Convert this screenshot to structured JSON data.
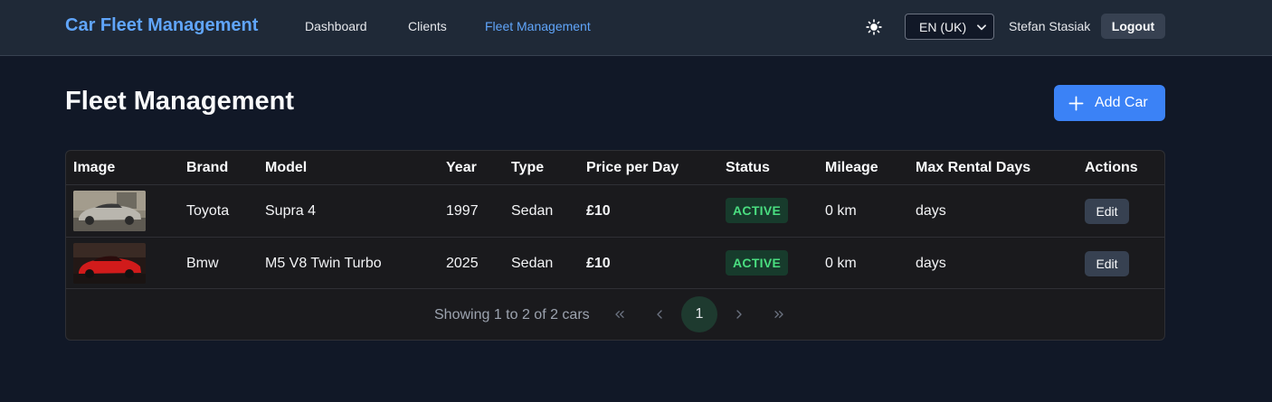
{
  "nav": {
    "brand": "Car Fleet Management",
    "links": [
      "Dashboard",
      "Clients",
      "Fleet Management"
    ],
    "active_link": "Fleet Management",
    "theme_icon": "sun-icon",
    "language": "EN (UK)",
    "user": "Stefan Stasiak",
    "logout_label": "Logout"
  },
  "page": {
    "title": "Fleet Management",
    "add_button_label": "Add Car"
  },
  "table": {
    "headers": [
      "Image",
      "Brand",
      "Model",
      "Year",
      "Type",
      "Price per Day",
      "Status",
      "Mileage",
      "Max Rental Days",
      "Actions"
    ],
    "rows": [
      {
        "brand": "Toyota",
        "model": "Supra 4",
        "year": "1997",
        "type": "Sedan",
        "price": "£10",
        "status": "ACTIVE",
        "mileage": "0 km",
        "max_days": "days",
        "action": "Edit"
      },
      {
        "brand": "Bmw",
        "model": "M5 V8 Twin Turbo",
        "year": "2025",
        "type": "Sedan",
        "price": "£10",
        "status": "ACTIVE",
        "mileage": "0 km",
        "max_days": "days",
        "action": "Edit"
      }
    ]
  },
  "pagination": {
    "summary": "Showing 1 to 2 of 2 cars",
    "current_page": "1"
  },
  "colors": {
    "accent": "#3b82f6",
    "brand": "#60a5fa",
    "status_active": "#4ade80",
    "background": "#111827"
  }
}
